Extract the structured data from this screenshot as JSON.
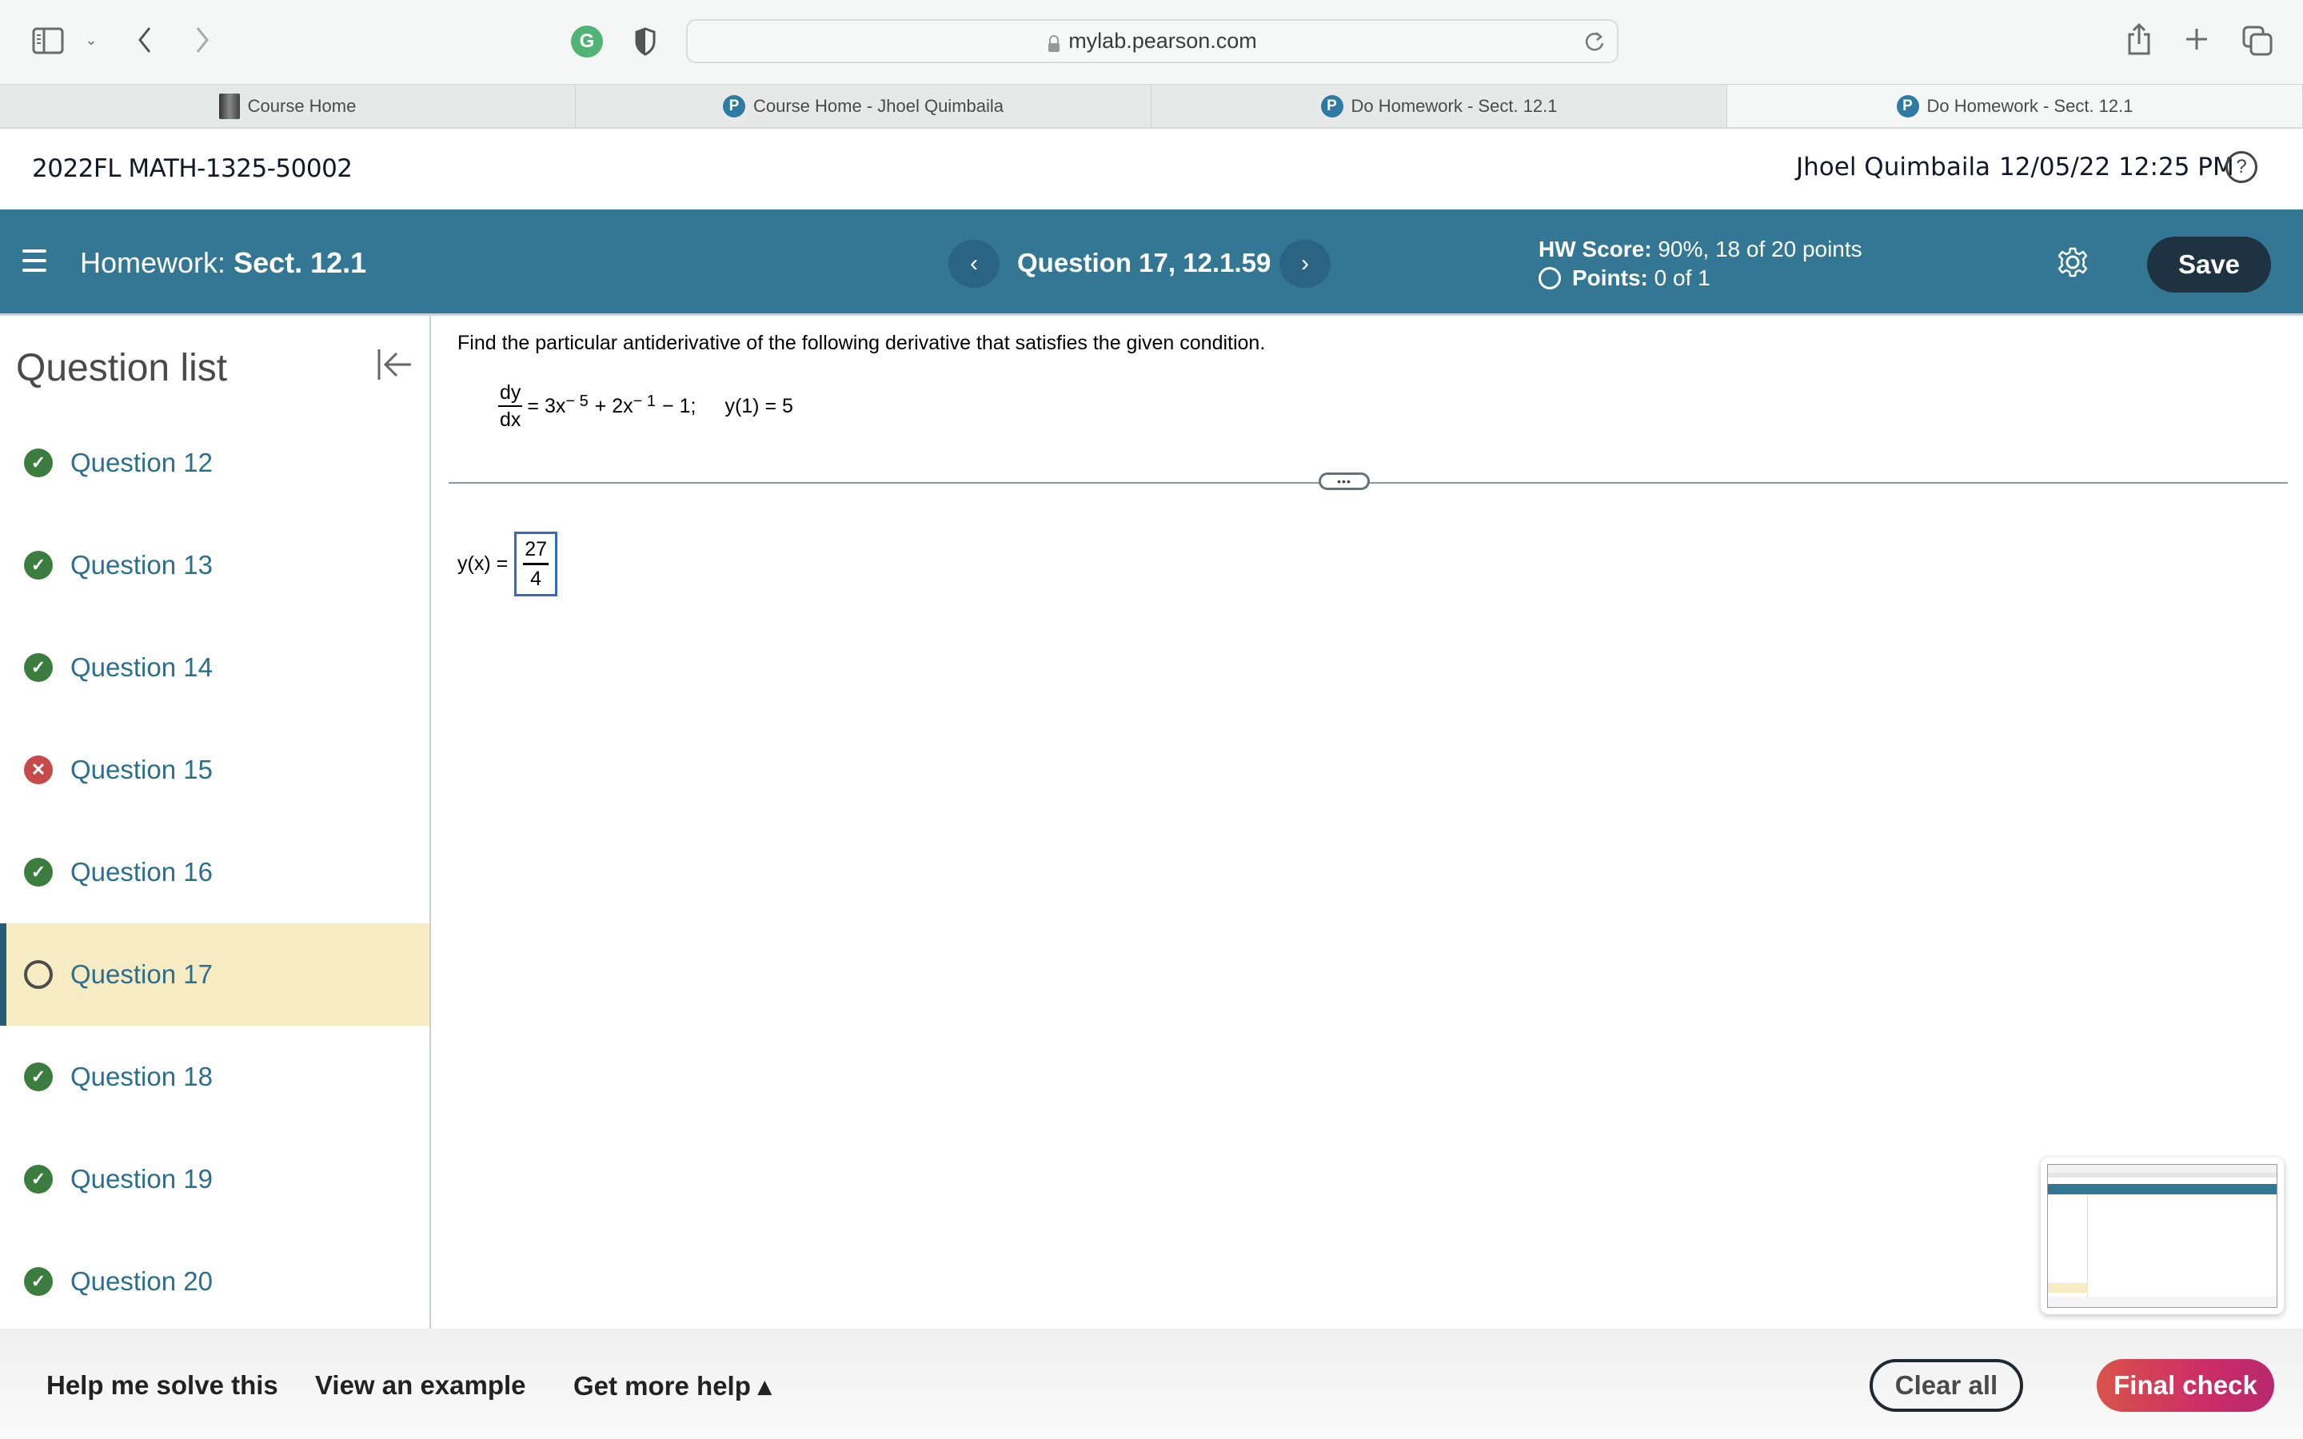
{
  "browser": {
    "url": "mylab.pearson.com",
    "tabs": [
      {
        "label": "Course Home",
        "icon": "book-icon",
        "active": false
      },
      {
        "label": "Course Home - Jhoel Quimbaila",
        "icon": "pearson-icon",
        "active": false
      },
      {
        "label": "Do Homework - Sect. 12.1",
        "icon": "pearson-icon",
        "active": false
      },
      {
        "label": "Do Homework - Sect. 12.1",
        "icon": "pearson-icon",
        "active": true
      }
    ],
    "extension_icon_letter": "G"
  },
  "course_header": {
    "title": "2022FL MATH-1325-50002",
    "user": "Jhoel Quimbaila",
    "datetime": "12/05/22 12:25 PM",
    "help_symbol": "?"
  },
  "hw_bar": {
    "label": "Homework:",
    "section": "Sect. 12.1",
    "question_title": "Question 17, 12.1.59",
    "prev_symbol": "‹",
    "next_symbol": "›",
    "score_label": "HW Score:",
    "score_value": "90%, 18 of 20 points",
    "points_label": "Points:",
    "points_value": "0 of 1",
    "save_label": "Save"
  },
  "sidebar": {
    "title": "Question list",
    "items": [
      {
        "label": "Question 12",
        "status": "correct"
      },
      {
        "label": "Question 13",
        "status": "correct"
      },
      {
        "label": "Question 14",
        "status": "correct"
      },
      {
        "label": "Question 15",
        "status": "incorrect"
      },
      {
        "label": "Question 16",
        "status": "correct"
      },
      {
        "label": "Question 17",
        "status": "unanswered",
        "current": true
      },
      {
        "label": "Question 18",
        "status": "correct"
      },
      {
        "label": "Question 19",
        "status": "correct"
      },
      {
        "label": "Question 20",
        "status": "correct"
      }
    ]
  },
  "question": {
    "prompt": "Find the particular antiderivative of the following derivative that satisfies the given condition.",
    "eq_num": "dy",
    "eq_den": "dx",
    "eq_part1": "= 3x",
    "eq_exp1": "− 5",
    "eq_part2": "+ 2x",
    "eq_exp2": "− 1",
    "eq_part3": "− 1;",
    "condition": "y(1) = 5",
    "divider_handle": "•••",
    "answer_lhs": "y(x) =",
    "answer_num": "27",
    "answer_den": "4"
  },
  "bottom_bar": {
    "help_me_solve": "Help me solve this",
    "view_example": "View an example",
    "get_more_help": "Get more help ▴",
    "clear_all": "Clear all",
    "final_check": "Final check"
  },
  "colors": {
    "hw_bar": "#337795",
    "correct": "#3a7d3f",
    "incorrect": "#c64a4a",
    "current_row": "#f7ebc3",
    "link": "#2b6f8e"
  }
}
